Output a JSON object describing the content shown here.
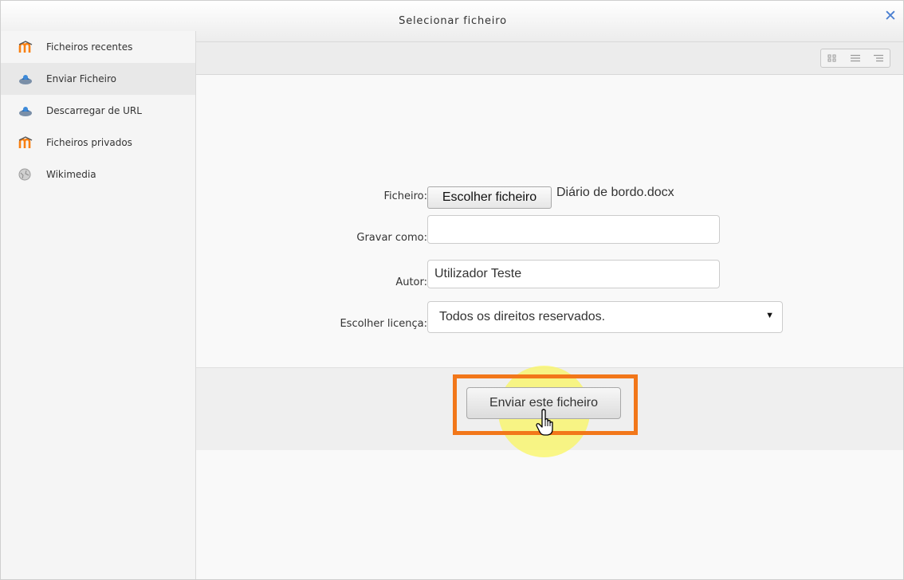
{
  "dialog": {
    "title": "Selecionar ficheiro",
    "close_icon": "close-icon"
  },
  "sidebar": {
    "items": [
      {
        "label": "Ficheiros recentes",
        "icon": "moodle-icon",
        "active": false
      },
      {
        "label": "Enviar Ficheiro",
        "icon": "upload-icon",
        "active": true
      },
      {
        "label": "Descarregar de URL",
        "icon": "url-download-icon",
        "active": false
      },
      {
        "label": "Ficheiros privados",
        "icon": "moodle-icon",
        "active": false
      },
      {
        "label": "Wikimedia",
        "icon": "wikimedia-icon",
        "active": false
      }
    ]
  },
  "toolbar": {
    "view_buttons": [
      "icons-view-icon",
      "list-view-icon",
      "tree-view-icon"
    ]
  },
  "form": {
    "file_label": "Ficheiro:",
    "file_button": "Escolher ficheiro",
    "file_name": "Diário de bordo.docx",
    "saveas_label": "Gravar como:",
    "saveas_value": "",
    "author_label": "Autor:",
    "author_value": "Utilizador Teste",
    "license_label": "Escolher licença:",
    "license_value": "Todos os direitos reservados."
  },
  "footer": {
    "upload_button": "Enviar este ficheiro"
  },
  "colors": {
    "highlight_border": "#f2771a",
    "cursor_glow": "#faf55a",
    "close_icon": "#4a7fd1",
    "moodle_orange": "#f98012"
  }
}
